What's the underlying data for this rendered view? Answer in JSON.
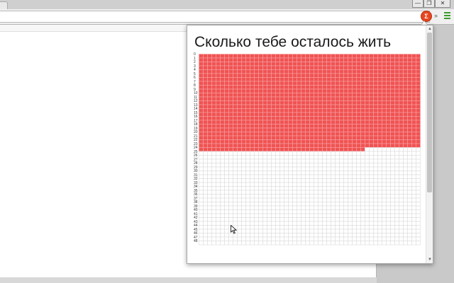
{
  "popup": {
    "title": "Сколько тебе осталось жить"
  },
  "life_grid": {
    "weeks_per_year": 52,
    "years_visible": 49,
    "full_years_lived": 24,
    "weeks_lived_in_current_year": 39,
    "lived_color": "#f05353",
    "remaining_color": "#ffffff",
    "grid_line_color": "#dcdcdc"
  },
  "year_labels": [
    "0",
    "1",
    "2",
    "3",
    "4",
    "5",
    "6",
    "7",
    "8",
    "9",
    "10",
    "11",
    "12",
    "13",
    "14",
    "15",
    "16",
    "17",
    "18",
    "19",
    "20",
    "21",
    "22",
    "23",
    "24",
    "25",
    "26",
    "27",
    "28",
    "29",
    "30",
    "31",
    "32",
    "33",
    "34",
    "35",
    "36",
    "37",
    "38",
    "39",
    "40",
    "41",
    "42",
    "43",
    "44",
    "45",
    "46",
    "47",
    "48"
  ],
  "extension": {
    "badge": "Σ",
    "accent": "#e8461f"
  },
  "toolbar": {
    "overflow": "»"
  },
  "window_buttons": {
    "minimize": "—",
    "restore": "❐",
    "close": "✕"
  }
}
